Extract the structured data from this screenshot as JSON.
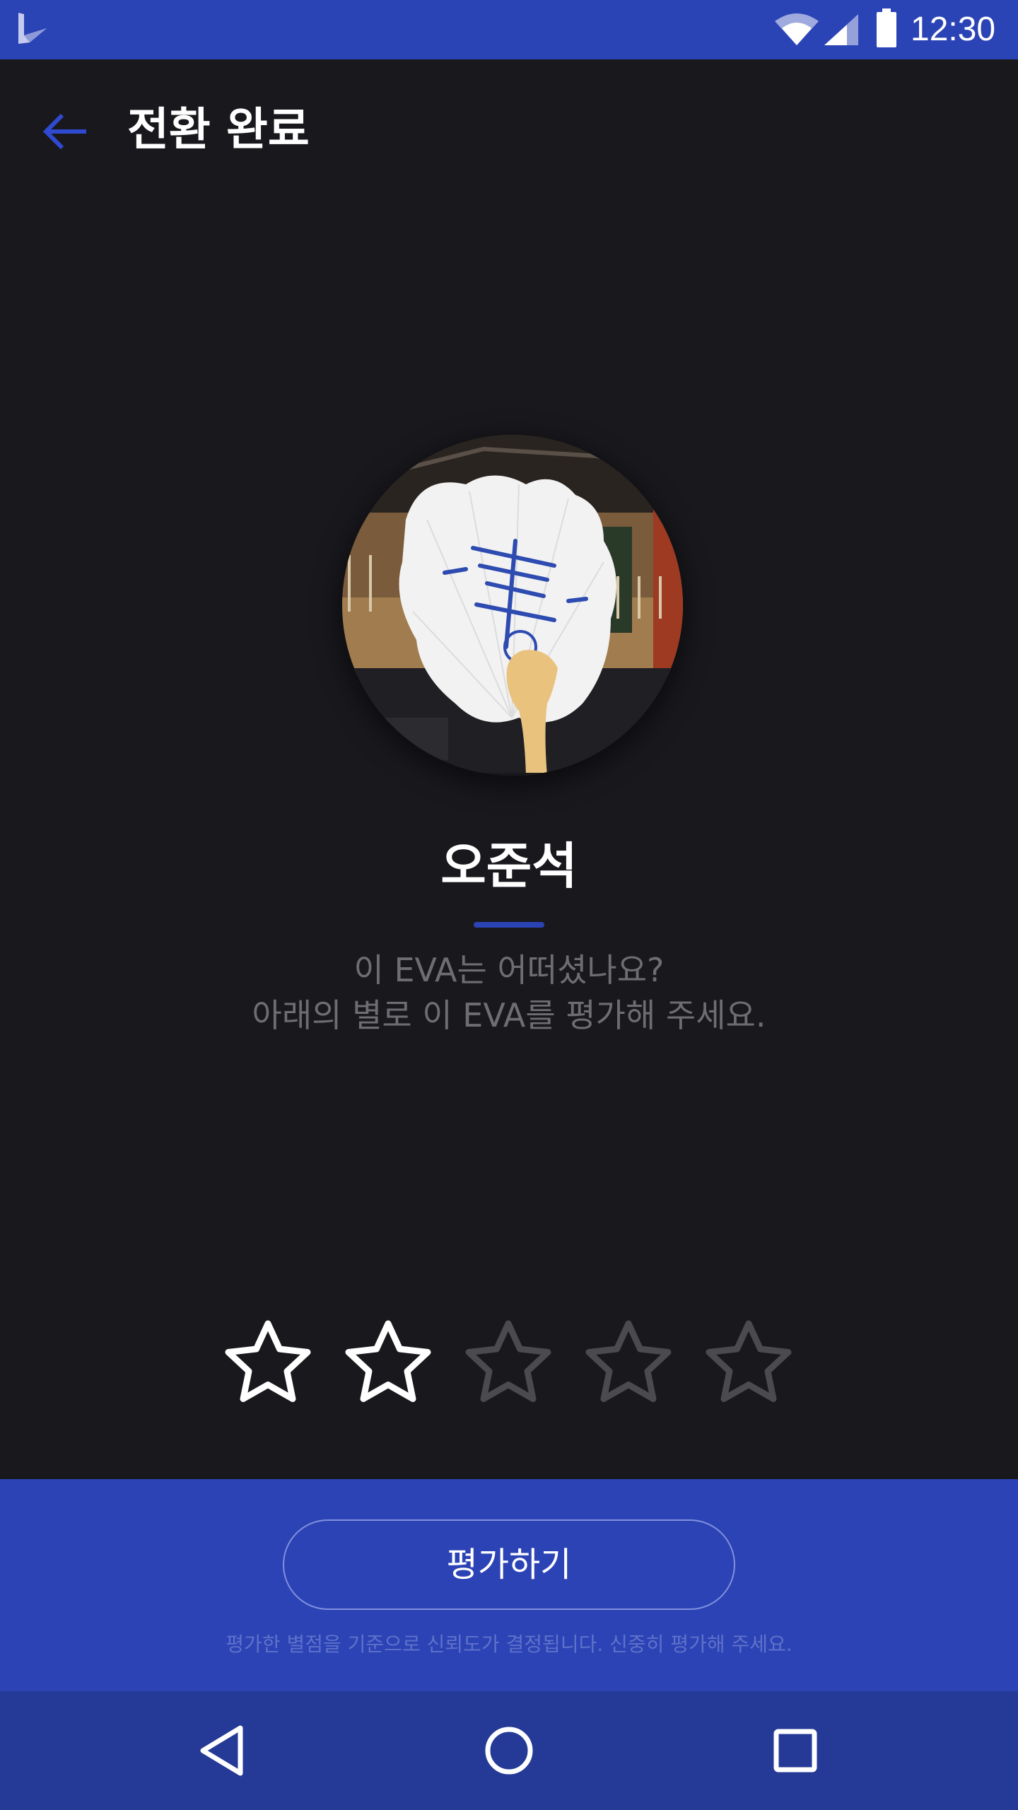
{
  "status_bar": {
    "time": "12:30",
    "icons": [
      "app-logo-icon",
      "wifi-icon",
      "signal-icon",
      "battery-icon"
    ]
  },
  "app_bar": {
    "back_icon": "arrow-left-icon",
    "title": "전환 완료"
  },
  "profile": {
    "name": "오준석",
    "prompt_line1": "이 EVA는 어떠셨나요?",
    "prompt_line2": "아래의 별로 이 EVA를 평가해 주세요."
  },
  "rating": {
    "max": 5,
    "value": 2
  },
  "footer": {
    "rate_button_label": "평가하기",
    "disclaimer": "평가한 별점을 기준으로 신뢰도가 결정됩니다. 신중히 평가해 주세요."
  },
  "nav_bar": {
    "icons": [
      "back-triangle-icon",
      "home-circle-icon",
      "recents-square-icon"
    ]
  },
  "colors": {
    "accent": "#2b44b5",
    "background": "#18181d",
    "star_filled_outline": "#ffffff",
    "star_empty_outline": "#4a4a4f",
    "prompt_text": "#6d6d72"
  }
}
